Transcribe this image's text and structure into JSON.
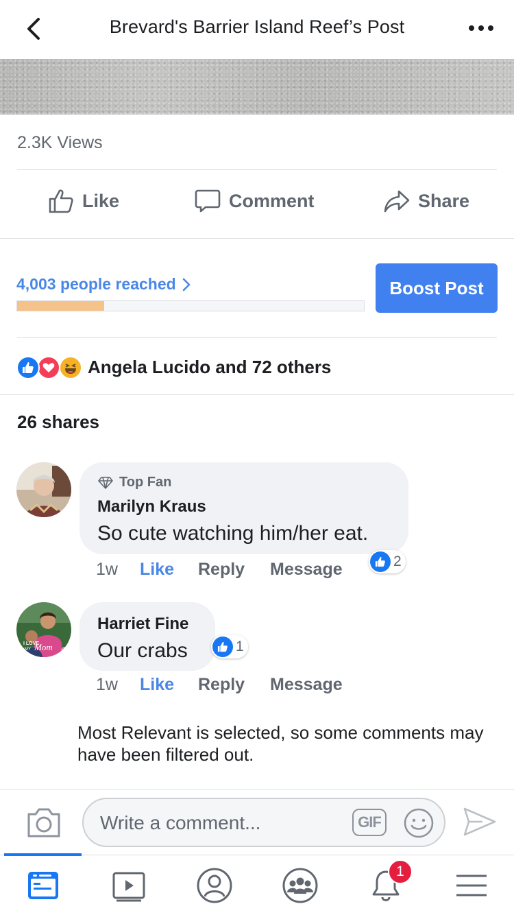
{
  "header": {
    "title": "Brevard's Barrier Island Reef’s Post"
  },
  "post": {
    "views": "2.3K Views",
    "actions": {
      "like": "Like",
      "comment": "Comment",
      "share": "Share"
    },
    "reach": {
      "label": "4,003 people reached",
      "progress_fraction": 0.25
    },
    "boost_label": "Boost Post",
    "reactions": {
      "icons": [
        "like-icon",
        "love-icon",
        "haha-icon"
      ],
      "text": "Angela Lucido and 72 others"
    },
    "shares": "26 shares"
  },
  "comments": [
    {
      "badge": "Top Fan",
      "name": "Marilyn Kraus",
      "text": "So cute watching him/her eat.",
      "like_count": "2",
      "time": "1w",
      "like": "Like",
      "reply": "Reply",
      "message": "Message"
    },
    {
      "name": "Harriet Fine",
      "text": "Our crabs",
      "like_count": "1",
      "time": "1w",
      "like": "Like",
      "reply": "Reply",
      "message": "Message",
      "avatar_caption": "I LOVE MY Mom"
    }
  ],
  "filter_note": "Most Relevant is selected, so some comments may have been filtered out.",
  "composer": {
    "placeholder": "Write a comment...",
    "gif": "GIF"
  },
  "tabbar": {
    "items": [
      "news-feed-icon",
      "watch-icon",
      "profile-icon",
      "groups-icon",
      "notifications-icon",
      "menu-icon"
    ],
    "notification_count": "1"
  },
  "colors": {
    "accent": "#1877f2",
    "boost": "#4080ef",
    "progress": "#f5c28a",
    "badge": "#e41e3f"
  }
}
